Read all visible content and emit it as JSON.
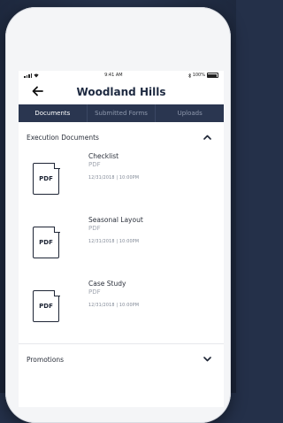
{
  "status_bar": {
    "time": "9:41 AM",
    "battery": "100%"
  },
  "header": {
    "title": "Woodland Hills"
  },
  "tabs": [
    {
      "label": "Documents",
      "active": true
    },
    {
      "label": "Submitted Forms",
      "active": false
    },
    {
      "label": "Uploads",
      "active": false
    }
  ],
  "sections": [
    {
      "title": "Execution Documents",
      "expanded": true,
      "documents": [
        {
          "name": "Checklist",
          "type": "PDF",
          "icon_text": "PDF",
          "date": "12/31/2018 | 10:00PM"
        },
        {
          "name": "Seasonal Layout",
          "type": "PDF",
          "icon_text": "PDF",
          "date": "12/31/2018 | 10:00PM"
        },
        {
          "name": "Case Study",
          "type": "PDF",
          "icon_text": "PDF",
          "date": "12/31/2018 | 10:00PM"
        }
      ]
    },
    {
      "title": "Promotions",
      "expanded": false
    }
  ],
  "colors": {
    "background": "#243049",
    "tab_bar": "#2a3650",
    "title": "#1d2940",
    "muted": "#a1a6b0"
  }
}
